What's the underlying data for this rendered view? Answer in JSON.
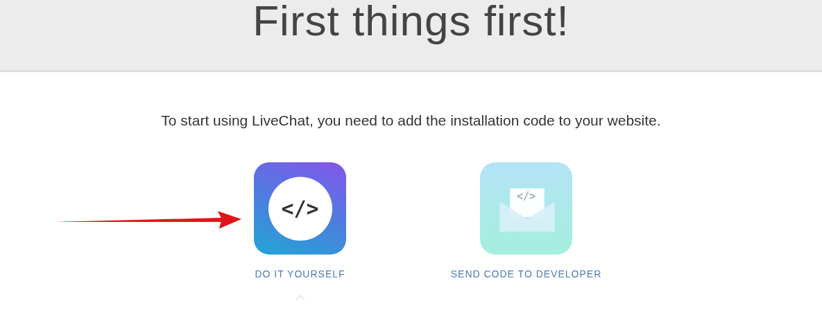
{
  "header": {
    "title": "First things first!"
  },
  "intro": "To start using LiveChat, you need to add the installation code to your website.",
  "options": [
    {
      "kind": "code",
      "glyph": "</>",
      "label": "DO IT YOURSELF",
      "selected": true
    },
    {
      "kind": "email",
      "glyph": "</>",
      "label": "SEND CODE TO DEVELOPER",
      "selected": false
    }
  ]
}
